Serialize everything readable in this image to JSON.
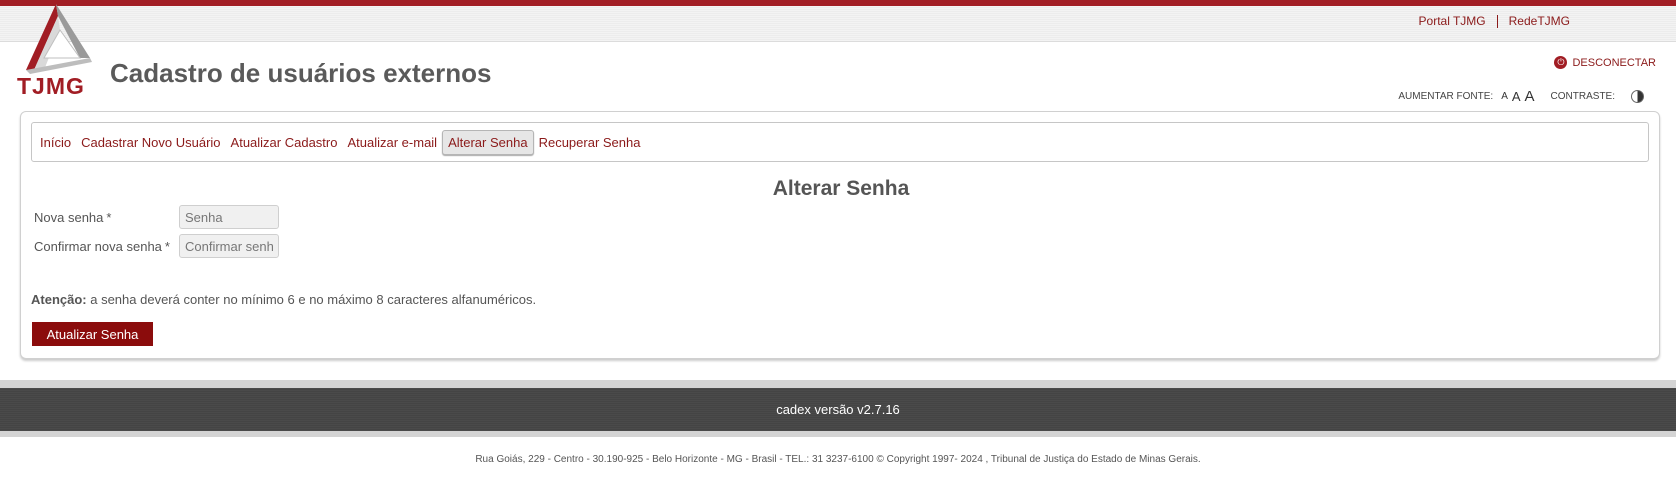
{
  "header": {
    "top_links": [
      "Portal TJMG",
      "RedeTJMG"
    ],
    "logo_text": "TJMG",
    "title": "Cadastro de usuários externos",
    "disconnect_label": "DESCONECTAR",
    "font_size_label": "AUMENTAR FONTE:",
    "font_sizes": [
      "A",
      "A",
      "A"
    ],
    "contrast_label": "CONTRASTE:"
  },
  "nav": {
    "items": [
      {
        "label": "Início",
        "active": false
      },
      {
        "label": "Cadastrar Novo Usuário",
        "active": false
      },
      {
        "label": "Atualizar Cadastro",
        "active": false
      },
      {
        "label": "Atualizar e-mail",
        "active": false
      },
      {
        "label": "Alterar Senha",
        "active": true
      },
      {
        "label": "Recuperar Senha",
        "active": false
      }
    ]
  },
  "form": {
    "title": "Alterar Senha",
    "new_password": {
      "label": "Nova senha",
      "required": "*",
      "placeholder": "Senha",
      "value": ""
    },
    "confirm_password": {
      "label": "Confirmar nova senha",
      "required": "*",
      "placeholder": "Confirmar senha",
      "value": ""
    },
    "attention_bold": "Atenção:",
    "attention_text": " a senha deverá conter no mínimo 6 e no máximo 8 caracteres alfanuméricos.",
    "submit_label": "Atualizar Senha"
  },
  "footer": {
    "version": "cadex versão v2.7.16",
    "address": "Rua Goiás, 229 - Centro - 30.190-925 - Belo Horizonte - MG - Brasil - TEL.: 31 3237-6100 © Copyright 1997- 2024 , Tribunal de Justiça do Estado de Minas Gerais."
  },
  "colors": {
    "brand": "#a11d24",
    "button": "#8b0c0c",
    "link": "#8b1a1a"
  },
  "icons": [
    "tjmg-logo-icon",
    "power-icon",
    "contrast-icon"
  ]
}
